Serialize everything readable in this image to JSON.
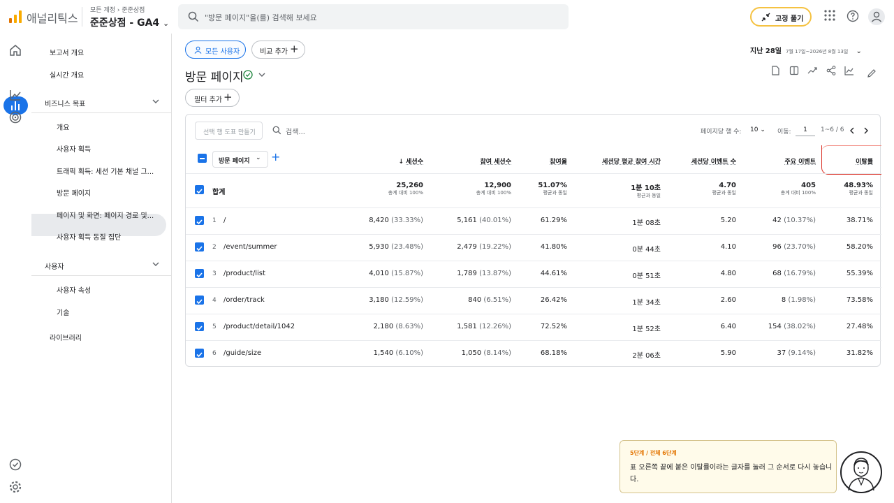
{
  "app": {
    "name": "애널리틱스",
    "crumb_a": "모든 계정",
    "crumb_b": "준준상점",
    "property": "준준상점 - GA4"
  },
  "search": {
    "placeholder": "\"방문 페이지\"을(를) 검색해 보세요"
  },
  "pin_button": "고정 풀기",
  "sidebar": {
    "items": [
      "보고서 개요",
      "실시간 개요"
    ],
    "section1": "비즈니스 목표",
    "section1_items": [
      "개요",
      "사용자 획득",
      "트래픽 획득: 세션 기본 채널 그...",
      "방문 페이지",
      "페이지 및 화면: 페이지 경로 및...",
      "사용자 획득 동질 집단"
    ],
    "section2": "사용자",
    "section2_items": [
      "사용자 속성",
      "기술"
    ],
    "library": "라이브러리"
  },
  "chips": {
    "all_users": "모든 사용자",
    "compare": "비교 추가",
    "filter": "필터 추가"
  },
  "date": {
    "label": "지난 28일",
    "range": "7월 17일~2026년 8월 13일"
  },
  "page_title": "방문 페이지",
  "table": {
    "viz_button": "선택 행 도표 만들기",
    "search": "검색...",
    "rows_per_page_label": "페이지당 행 수:",
    "rows_per_page": "10",
    "goto_label": "이동:",
    "goto_value": "1",
    "range": "1~6 / 6",
    "dim_selector": "방문 페이지",
    "headers": [
      "세션수",
      "참여 세션수",
      "참여율",
      "세션당 평균 참여 시간",
      "세션당 이벤트 수",
      "주요 이벤트",
      "이탈률"
    ],
    "total_label": "합계",
    "totals": [
      {
        "v": "25,260",
        "s": "총계 대비 100%"
      },
      {
        "v": "12,900",
        "s": "총계 대비 100%"
      },
      {
        "v": "51.07%",
        "s": "평균과 동일"
      },
      {
        "v": "1분 10초",
        "s": "평균과 동일"
      },
      {
        "v": "4.70",
        "s": "평균과 동일"
      },
      {
        "v": "405",
        "s": "총계 대비 100%"
      },
      {
        "v": "48.93%",
        "s": "평균과 동일"
      }
    ],
    "rows": [
      {
        "n": "1",
        "path": "/",
        "c0": "8,420",
        "p0": "(33.33%)",
        "c1": "5,161",
        "p1": "(40.01%)",
        "c2": "61.29%",
        "c3": "1분 08초",
        "c4": "5.20",
        "c5": "42",
        "p5": "(10.37%)",
        "c6": "38.71%"
      },
      {
        "n": "2",
        "path": "/event/summer",
        "c0": "5,930",
        "p0": "(23.48%)",
        "c1": "2,479",
        "p1": "(19.22%)",
        "c2": "41.80%",
        "c3": "0분 44초",
        "c4": "4.10",
        "c5": "96",
        "p5": "(23.70%)",
        "c6": "58.20%"
      },
      {
        "n": "3",
        "path": "/product/list",
        "c0": "4,010",
        "p0": "(15.87%)",
        "c1": "1,789",
        "p1": "(13.87%)",
        "c2": "44.61%",
        "c3": "0분 51초",
        "c4": "4.80",
        "c5": "68",
        "p5": "(16.79%)",
        "c6": "55.39%"
      },
      {
        "n": "4",
        "path": "/order/track",
        "c0": "3,180",
        "p0": "(12.59%)",
        "c1": "840",
        "p1": "(6.51%)",
        "c2": "26.42%",
        "c3": "1분 34초",
        "c4": "2.60",
        "c5": "8",
        "p5": "(1.98%)",
        "c6": "73.58%"
      },
      {
        "n": "5",
        "path": "/product/detail/1042",
        "c0": "2,180",
        "p0": "(8.63%)",
        "c1": "1,581",
        "p1": "(12.26%)",
        "c2": "72.52%",
        "c3": "1분 52초",
        "c4": "6.40",
        "c5": "154",
        "p5": "(38.02%)",
        "c6": "27.48%"
      },
      {
        "n": "6",
        "path": "/guide/size",
        "c0": "1,540",
        "p0": "(6.10%)",
        "c1": "1,050",
        "p1": "(8.14%)",
        "c2": "68.18%",
        "c3": "2분 06초",
        "c4": "5.90",
        "c5": "37",
        "p5": "(9.14%)",
        "c6": "31.82%"
      }
    ]
  },
  "tooltip": {
    "step": "5단계 / 전체 6단계",
    "text": "표 오른쪽 끝에 붙은 이탈률이라는 글자를 눌러 그 순서로 다시 놓습니다."
  },
  "colors": {
    "accent": "#1a73e8",
    "logo": "#f9ab00",
    "highlight": "#d93025",
    "tip_bg": "#fffbea"
  }
}
